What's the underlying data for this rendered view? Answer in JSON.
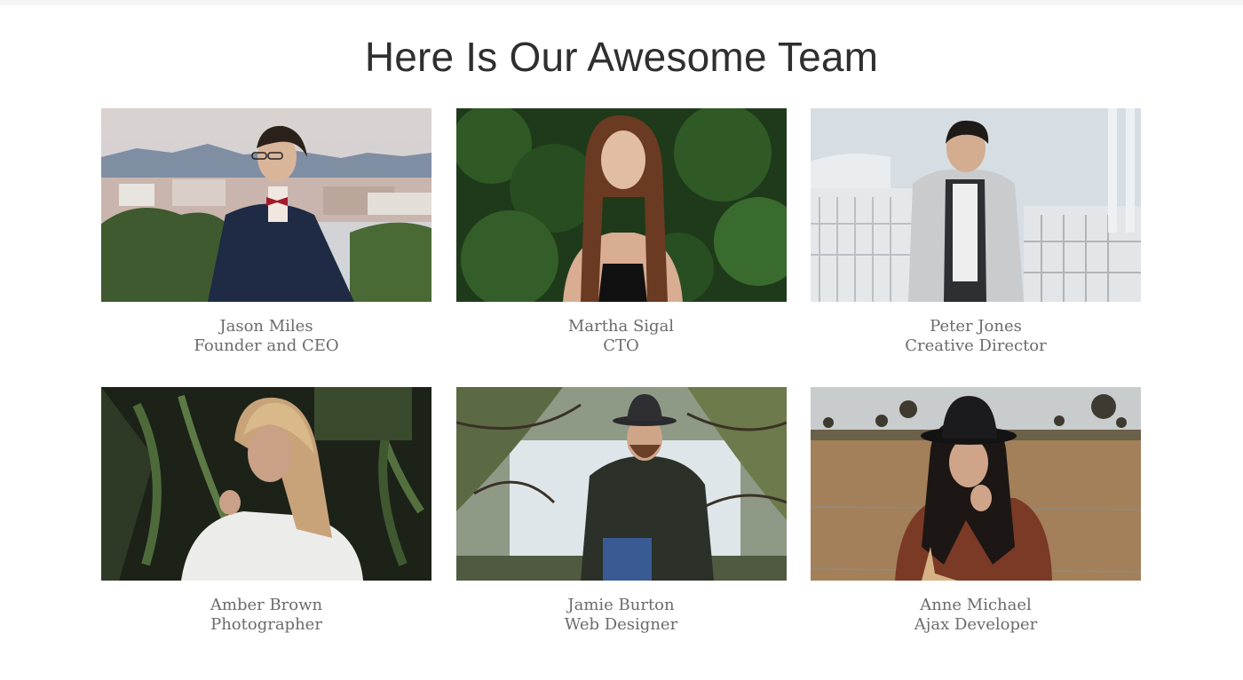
{
  "header": {
    "title": "Here Is Our Awesome Team"
  },
  "team": [
    {
      "name": "Jason Miles",
      "role": "Founder and CEO"
    },
    {
      "name": "Martha Sigal",
      "role": "CTO"
    },
    {
      "name": "Peter Jones",
      "role": "Creative Director"
    },
    {
      "name": "Amber Brown",
      "role": "Photographer"
    },
    {
      "name": "Jamie Burton",
      "role": "Web Designer"
    },
    {
      "name": "Anne Michael",
      "role": "Ajax Developer"
    }
  ],
  "colors": {
    "title": "#2f2f2f",
    "caption": "#6b6b6b",
    "background": "#ffffff"
  }
}
